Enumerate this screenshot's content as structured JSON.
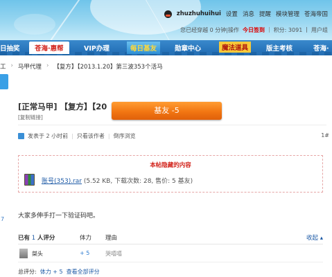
{
  "banner": {
    "username": "zhuzhuhuihui",
    "user_links": [
      "设置",
      "消息",
      "提醒",
      "模块管理",
      "苍海帝国"
    ],
    "online_status": "您已经穿越 0 分钟|操作",
    "checkin_label": "今日签到",
    "points": "积分: 3091",
    "user_group": "用户组"
  },
  "nav": {
    "items": [
      "日抽奖",
      "苍海·惠帮",
      "VIP办理",
      "每日基友",
      "勋章中心",
      "魔法道具",
      "版主考核",
      "苍海·"
    ]
  },
  "breadcrumb": [
    "工",
    "马甲代理",
    "【复方】【2013.1.20】第三波353个活马"
  ],
  "thread": {
    "title": "[正常马甲] 【复方】【20",
    "copy_link": "[复制链接]",
    "popup_text": "基友 -5",
    "meta": [
      "发表于 2 小时前",
      "只看该作者",
      "倒序浏览"
    ],
    "floor": "1#"
  },
  "hidden_box": {
    "title": "本帖隐藏的内容",
    "file_name": "账号(353).rar",
    "file_info": "(5.52 KB, 下载次数: 28, 售价: 5 基友)"
  },
  "post": {
    "text": "大家多伸手打一下验证码吧。",
    "edge_num": "7"
  },
  "rating": {
    "header_prefix": "已有",
    "count": "1",
    "header_suffix": "人评分",
    "col_score": "体力",
    "col_reason": "理由",
    "collapse": "收起 ▴",
    "rows": [
      {
        "user": "桀头",
        "score": "+ 5",
        "reason": "哭嘻嘻"
      }
    ],
    "total_label": "总评分:",
    "total_value": "体力 + 5",
    "view_all": "查看全部评分"
  }
}
